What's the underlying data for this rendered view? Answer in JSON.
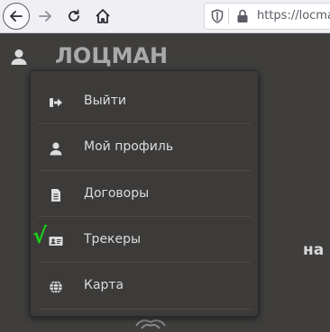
{
  "browser": {
    "url_text": "https://locman",
    "icons": {
      "back": "arrow-left-icon",
      "forward": "arrow-right-icon",
      "reload": "reload-icon",
      "home": "home-icon",
      "shield": "shield-icon",
      "lock": "lock-icon"
    }
  },
  "header": {
    "brand": "ЛОЦМАН",
    "user_icon": "user-icon"
  },
  "page": {
    "partial_text": "на"
  },
  "menu": {
    "items": [
      {
        "label": "Выйти",
        "icon": "sign-out-icon"
      },
      {
        "label": "Мой профиль",
        "icon": "user-icon"
      },
      {
        "label": "Договоры",
        "icon": "document-icon"
      },
      {
        "label": "Трекеры",
        "icon": "id-card-icon"
      },
      {
        "label": "Карта",
        "icon": "globe-icon"
      }
    ],
    "checkmark": "√",
    "check_color": "#19d319"
  },
  "colors": {
    "page_bg": "#3f3e3d",
    "menu_bg": "#3c3b3a",
    "menu_text": "#dcdcdc",
    "brand_text": "#a9a9a9"
  }
}
